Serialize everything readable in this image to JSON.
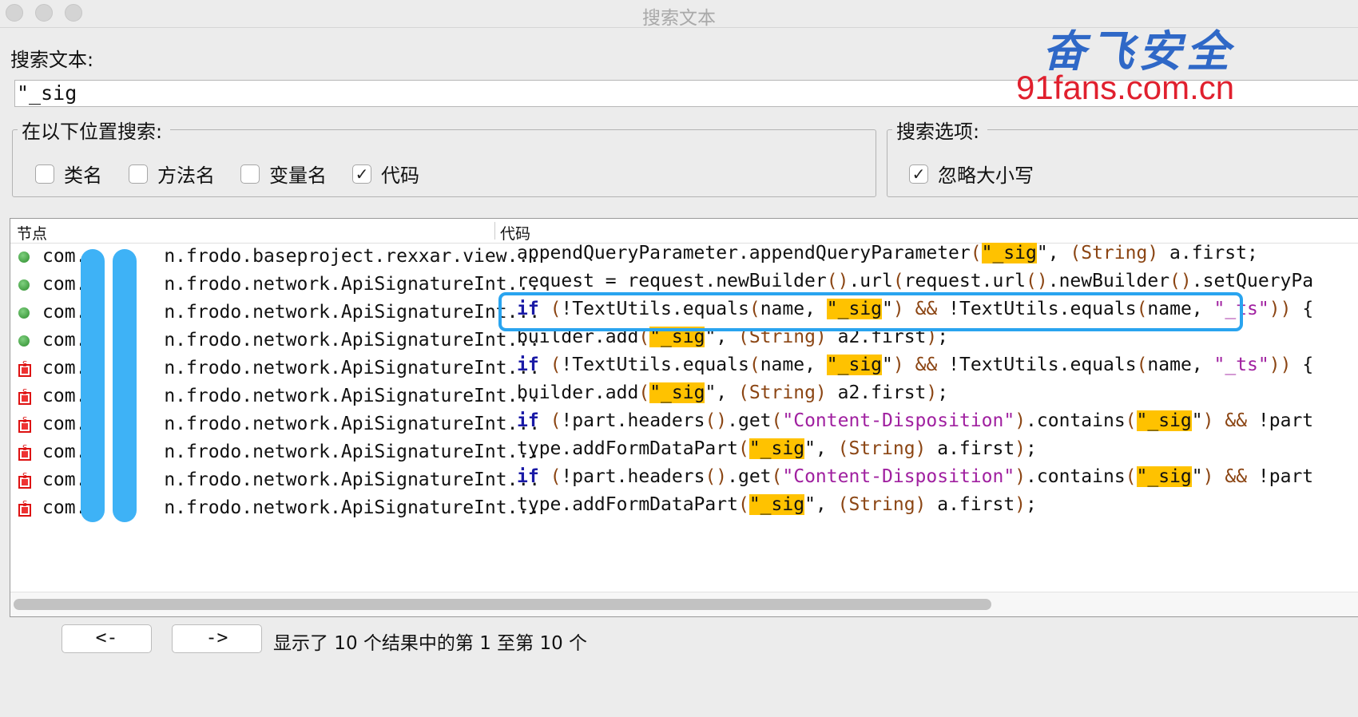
{
  "window": {
    "title": "搜索文本"
  },
  "search": {
    "label": "搜索文本:",
    "value": "\"_sig"
  },
  "location_group": {
    "title": "在以下位置搜索:",
    "options": [
      {
        "label": "类名",
        "checked": false
      },
      {
        "label": "方法名",
        "checked": false
      },
      {
        "label": "变量名",
        "checked": false
      },
      {
        "label": "代码",
        "checked": true
      }
    ]
  },
  "options_group": {
    "title": "搜索选项:",
    "options": [
      {
        "label": "忽略大小写",
        "checked": true
      }
    ]
  },
  "results": {
    "columns": {
      "node": "节点",
      "code": "代码"
    },
    "check_mark": "✓",
    "rows": [
      {
        "icon": "green-dot-icon",
        "node": "com.   u   n.frodo.baseproject.rexxar.view..."
      },
      {
        "icon": "green-dot-icon",
        "node": "com.   u   n.frodo.network.ApiSignatureInt..."
      },
      {
        "icon": "green-dot-icon",
        "node": "com.   u   n.frodo.network.ApiSignatureInt..."
      },
      {
        "icon": "green-dot-icon",
        "node": "com.   u   n.frodo.network.ApiSignatureInt..."
      },
      {
        "icon": "static-method-icon",
        "node": "com.   u   n.frodo.network.ApiSignatureInt..."
      },
      {
        "icon": "static-method-icon",
        "node": "com.   u   n.frodo.network.ApiSignatureInt..."
      },
      {
        "icon": "static-method-icon",
        "node": "com.   u   n.frodo.network.ApiSignatureInt..."
      },
      {
        "icon": "static-method-icon",
        "node": "com.   u   n.frodo.network.ApiSignatureInt..."
      },
      {
        "icon": "static-method-icon",
        "node": "com.   u   n.frodo.network.ApiSignatureInt..."
      },
      {
        "icon": "static-method-icon",
        "node": "com.   u   n.frodo.network.ApiSignatureInt..."
      }
    ],
    "code_lines": [
      [
        [
          "t",
          "appendQueryParameter.appendQueryParameter"
        ],
        [
          "o",
          "("
        ],
        [
          "h",
          "\"_sig"
        ],
        [
          "t",
          "\", "
        ],
        [
          "o",
          "(String)"
        ],
        [
          "t",
          " a.first;"
        ]
      ],
      [
        [
          "t",
          "request = request.newBuilder"
        ],
        [
          "o",
          "()"
        ],
        [
          "t",
          ".url"
        ],
        [
          "o",
          "("
        ],
        [
          "t",
          "request.url"
        ],
        [
          "o",
          "()"
        ],
        [
          "t",
          ".newBuilder"
        ],
        [
          "o",
          "()"
        ],
        [
          "t",
          ".setQueryPa"
        ]
      ],
      [
        [
          "k",
          "if"
        ],
        [
          "t",
          " "
        ],
        [
          "o",
          "("
        ],
        [
          "t",
          "!TextUtils.equals"
        ],
        [
          "o",
          "("
        ],
        [
          "t",
          "name, "
        ],
        [
          "h",
          "\"_sig"
        ],
        [
          "t",
          "\""
        ],
        [
          "o",
          ")"
        ],
        [
          "t",
          " "
        ],
        [
          "o",
          "&&"
        ],
        [
          "t",
          " !TextUtils.equals"
        ],
        [
          "o",
          "("
        ],
        [
          "t",
          "name, "
        ],
        [
          "s",
          "\"_ts\""
        ],
        [
          "o",
          "))"
        ],
        [
          "t",
          " {"
        ]
      ],
      [
        [
          "t",
          "builder.add"
        ],
        [
          "o",
          "("
        ],
        [
          "h",
          "\"_sig"
        ],
        [
          "t",
          "\", "
        ],
        [
          "o",
          "(String)"
        ],
        [
          "t",
          " a2.first"
        ],
        [
          "o",
          ")"
        ],
        [
          "t",
          ";"
        ]
      ],
      [
        [
          "k",
          "if"
        ],
        [
          "t",
          " "
        ],
        [
          "o",
          "("
        ],
        [
          "t",
          "!TextUtils.equals"
        ],
        [
          "o",
          "("
        ],
        [
          "t",
          "name, "
        ],
        [
          "h",
          "\"_sig"
        ],
        [
          "t",
          "\""
        ],
        [
          "o",
          ")"
        ],
        [
          "t",
          " "
        ],
        [
          "o",
          "&&"
        ],
        [
          "t",
          " !TextUtils.equals"
        ],
        [
          "o",
          "("
        ],
        [
          "t",
          "name, "
        ],
        [
          "s",
          "\"_ts\""
        ],
        [
          "o",
          "))"
        ],
        [
          "t",
          " {"
        ]
      ],
      [
        [
          "t",
          "builder.add"
        ],
        [
          "o",
          "("
        ],
        [
          "h",
          "\"_sig"
        ],
        [
          "t",
          "\", "
        ],
        [
          "o",
          "(String)"
        ],
        [
          "t",
          " a2.first"
        ],
        [
          "o",
          ")"
        ],
        [
          "t",
          ";"
        ]
      ],
      [
        [
          "k",
          "if"
        ],
        [
          "t",
          " "
        ],
        [
          "o",
          "("
        ],
        [
          "t",
          "!part.headers"
        ],
        [
          "o",
          "()"
        ],
        [
          "t",
          ".get"
        ],
        [
          "o",
          "("
        ],
        [
          "s",
          "\"Content-Disposition\""
        ],
        [
          "o",
          ")"
        ],
        [
          "t",
          ".contains"
        ],
        [
          "o",
          "("
        ],
        [
          "h",
          "\"_sig"
        ],
        [
          "t",
          "\""
        ],
        [
          "o",
          ")"
        ],
        [
          "t",
          " "
        ],
        [
          "o",
          "&&"
        ],
        [
          "t",
          " !part"
        ]
      ],
      [
        [
          "t",
          "type.addFormDataPart"
        ],
        [
          "o",
          "("
        ],
        [
          "h",
          "\"_sig"
        ],
        [
          "t",
          "\", "
        ],
        [
          "o",
          "(String)"
        ],
        [
          "t",
          " a.first"
        ],
        [
          "o",
          ")"
        ],
        [
          "t",
          ";"
        ]
      ],
      [
        [
          "k",
          "if"
        ],
        [
          "t",
          " "
        ],
        [
          "o",
          "("
        ],
        [
          "t",
          "!part.headers"
        ],
        [
          "o",
          "()"
        ],
        [
          "t",
          ".get"
        ],
        [
          "o",
          "("
        ],
        [
          "s",
          "\"Content-Disposition\""
        ],
        [
          "o",
          ")"
        ],
        [
          "t",
          ".contains"
        ],
        [
          "o",
          "("
        ],
        [
          "h",
          "\"_sig"
        ],
        [
          "t",
          "\""
        ],
        [
          "o",
          ")"
        ],
        [
          "t",
          " "
        ],
        [
          "o",
          "&&"
        ],
        [
          "t",
          " !part"
        ]
      ],
      [
        [
          "t",
          "type.addFormDataPart"
        ],
        [
          "o",
          "("
        ],
        [
          "h",
          "\"_sig"
        ],
        [
          "t",
          "\", "
        ],
        [
          "o",
          "(String)"
        ],
        [
          "t",
          " a.first"
        ],
        [
          "o",
          ")"
        ],
        [
          "t",
          ";"
        ]
      ]
    ]
  },
  "footer": {
    "prev_label": "<-",
    "next_label": "->",
    "status": "显示了 10 个结果中的第 1 至第 10 个"
  },
  "watermark": {
    "brand": "奋飞安全",
    "url": "91fans.com.cn"
  },
  "colors": {
    "highlight": "#ffc200",
    "annotation": "#29a4ef",
    "keyword": "#1a1aa6",
    "string": "#a020a0"
  }
}
